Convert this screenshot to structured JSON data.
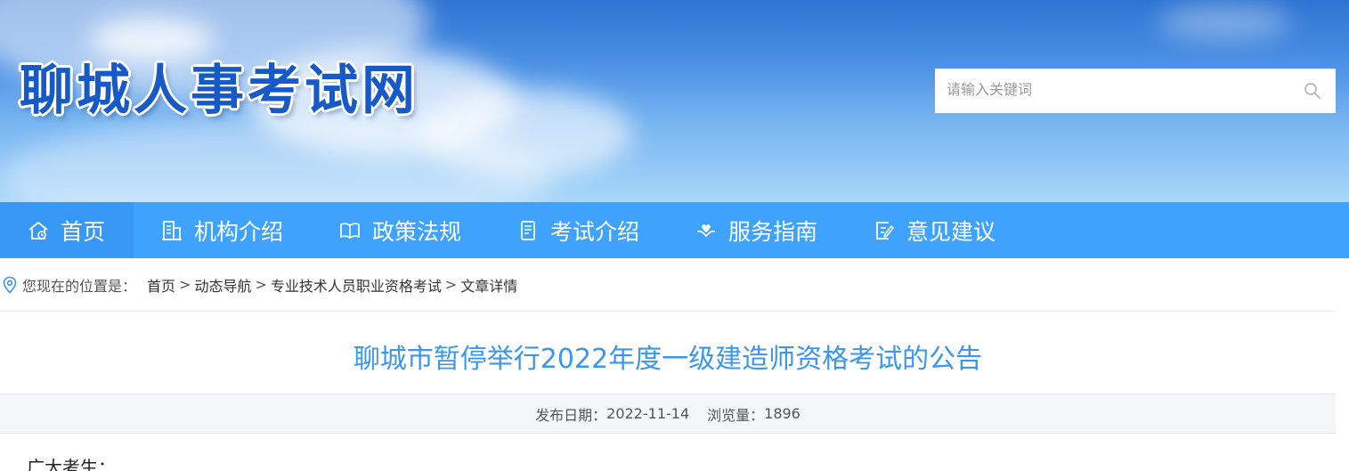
{
  "header": {
    "site_title": "聊城人事考试网",
    "search": {
      "placeholder": "请输入关键词",
      "value": "",
      "icon": "search-icon"
    }
  },
  "nav": {
    "items": [
      {
        "label": "首页",
        "icon": "home-icon",
        "active": true
      },
      {
        "label": "机构介绍",
        "icon": "building-icon"
      },
      {
        "label": "政策法规",
        "icon": "book-icon"
      },
      {
        "label": "考试介绍",
        "icon": "document-icon"
      },
      {
        "label": "服务指南",
        "icon": "heart-hand-icon"
      },
      {
        "label": "意见建议",
        "icon": "edit-icon"
      }
    ],
    "colors": {
      "bar": "#3fa2fc",
      "active": "#3798f5"
    }
  },
  "breadcrumb": {
    "lead": "您现在的位置是：",
    "items": [
      "首页",
      "动态导航",
      "专业技术人员职业资格考试",
      "文章详情"
    ],
    "separator": ">"
  },
  "article": {
    "title": "聊城市暂停举行2022年度一级建造师资格考试的公告",
    "date_label": "发布日期：",
    "date": "2022-11-14",
    "views_label": "浏览量：",
    "views": "1896",
    "first_line": "广大考生："
  },
  "colors": {
    "title": "#3a96ee",
    "logo": "#1659c7"
  }
}
